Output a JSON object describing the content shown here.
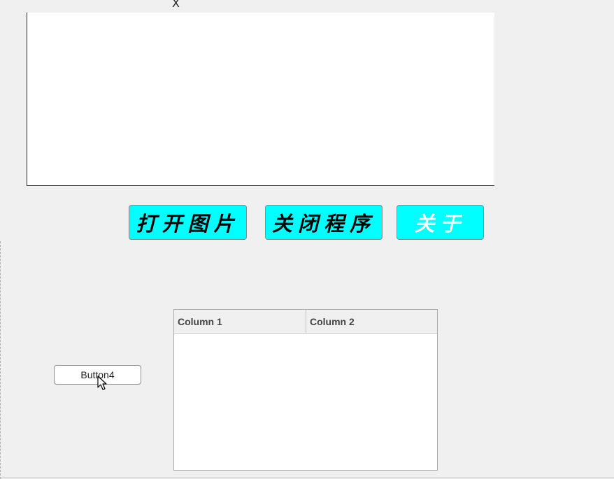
{
  "axes": {
    "xlabel": "X"
  },
  "buttons": {
    "open_image": "打开图片",
    "close_program": "关闭程序",
    "about": "关于",
    "button4": "Button4"
  },
  "table": {
    "columns": [
      "Column 1",
      "Column 2"
    ],
    "rows": []
  },
  "colors": {
    "accent_button": "#00ffff",
    "background": "#f0f0f0"
  }
}
